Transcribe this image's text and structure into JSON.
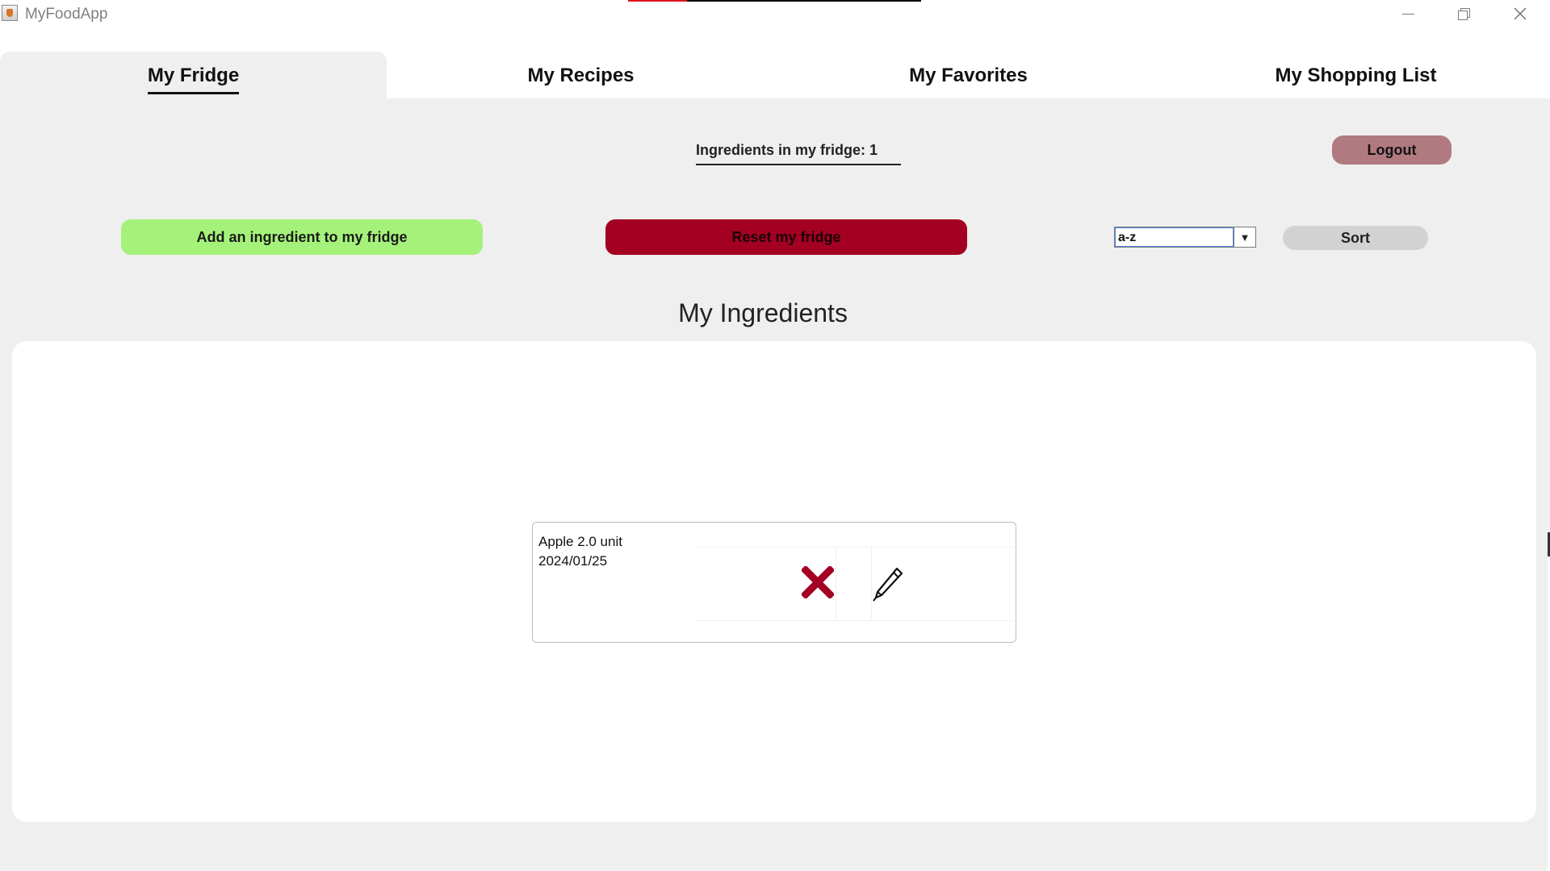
{
  "window": {
    "title": "MyFoodApp",
    "progress_fraction": 0.2
  },
  "tabs": [
    {
      "label": "My Fridge",
      "active": true
    },
    {
      "label": "My Recipes",
      "active": false
    },
    {
      "label": "My Favorites",
      "active": false
    },
    {
      "label": "My Shopping List",
      "active": false
    }
  ],
  "fridge": {
    "count_label": "Ingredients in my fridge: 1",
    "logout_label": "Logout",
    "add_label": "Add an ingredient to my fridge",
    "reset_label": "Reset my fridge",
    "sort_value": "a-z",
    "sort_label": "Sort",
    "section_title": "My Ingredients",
    "ingredients": [
      {
        "line1": "Apple 2.0 unit",
        "line2": "2024/01/25"
      }
    ]
  },
  "colors": {
    "add": "#a5f27a",
    "reset": "#a30022",
    "logout": "#b17a80",
    "sort": "#d2d2d2",
    "delete_icon": "#a30022",
    "progress": "#e0121e"
  },
  "icons": {
    "delete": "close-x-icon",
    "edit": "pencil-icon"
  }
}
